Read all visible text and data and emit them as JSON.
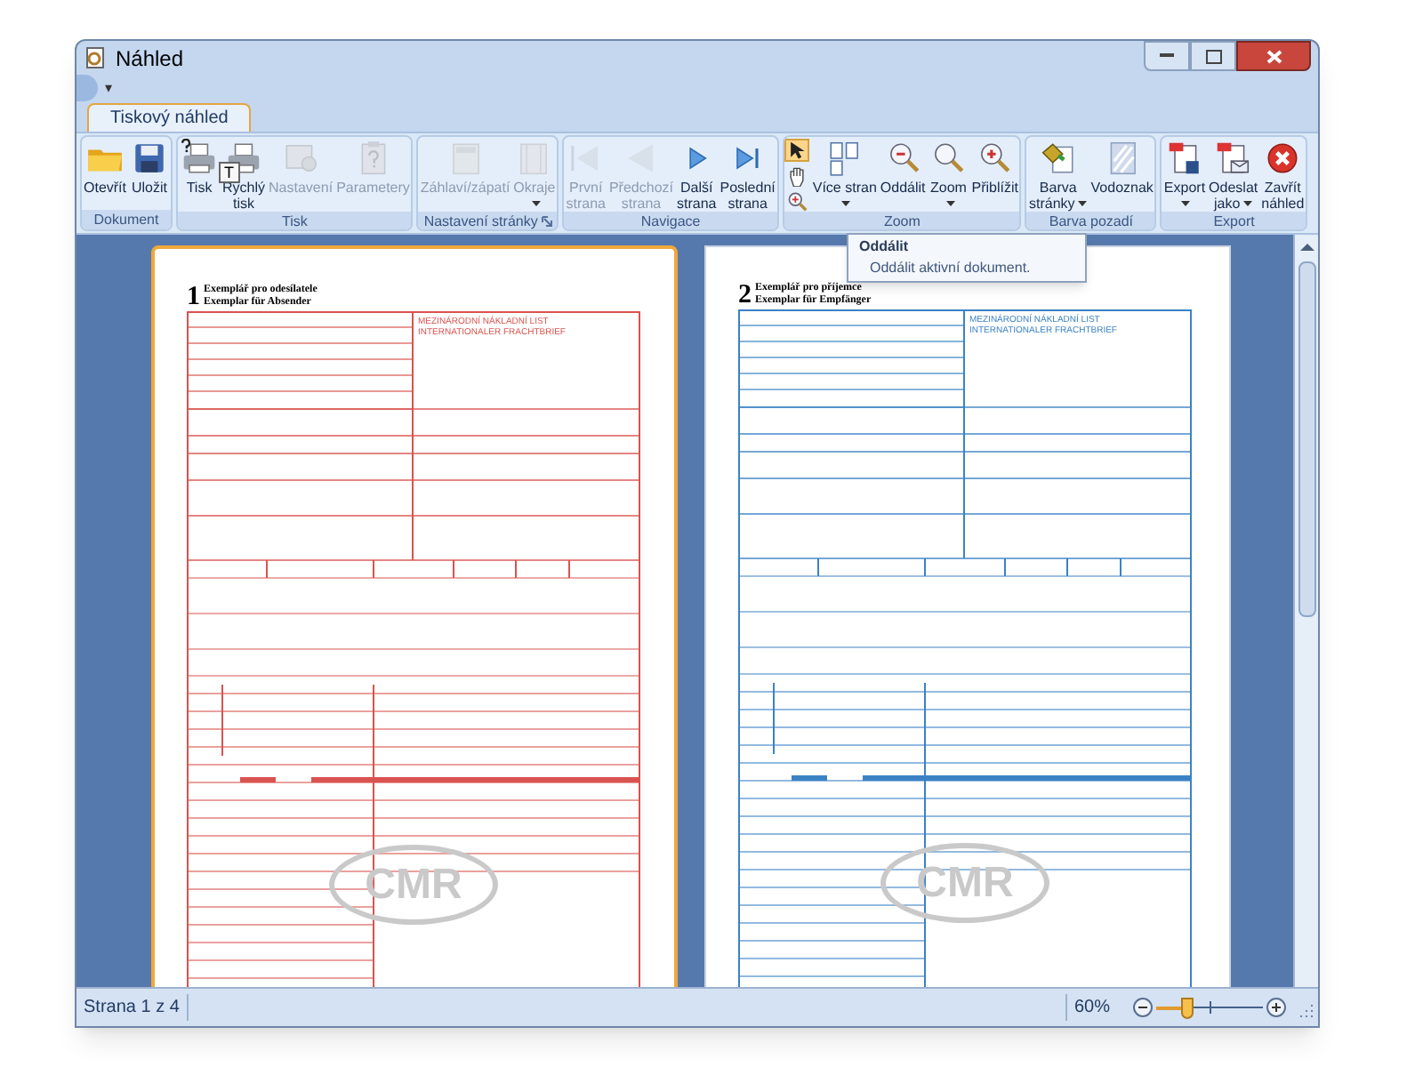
{
  "window": {
    "title": "Náhled"
  },
  "quick_access": {
    "menu_glyph": "▾"
  },
  "tabs": [
    {
      "label": "Tiskový náhled",
      "selected": true
    }
  ],
  "keytip": "T",
  "ribbon_groups": [
    {
      "label": "Dokument",
      "launcher": false,
      "buttons": [
        {
          "kind": "folder",
          "lines": [
            "Otevřít"
          ],
          "disabled": false,
          "dropdown": false
        },
        {
          "kind": "save",
          "lines": [
            "Uložit"
          ],
          "disabled": false,
          "dropdown": false
        }
      ]
    },
    {
      "label": "Tisk",
      "launcher": false,
      "buttons": [
        {
          "kind": "print-dialog",
          "lines": [
            "Tisk"
          ],
          "disabled": false,
          "dropdown": false
        },
        {
          "kind": "print",
          "lines": [
            "Rychlý",
            "tisk"
          ],
          "disabled": false,
          "dropdown": false
        },
        {
          "kind": "settings",
          "lines": [
            "Nastavení"
          ],
          "disabled": true,
          "dropdown": false
        },
        {
          "kind": "parameters",
          "lines": [
            "Parametery"
          ],
          "disabled": true,
          "dropdown": false
        }
      ]
    },
    {
      "label": "Nastavení stránky",
      "launcher": true,
      "buttons": [
        {
          "kind": "header",
          "lines": [
            "Záhlaví/zápatí"
          ],
          "disabled": true,
          "dropdown": false
        },
        {
          "kind": "margins",
          "lines": [
            "Okraje"
          ],
          "disabled": true,
          "dropdown": true
        }
      ]
    },
    {
      "label": "Navigace",
      "launcher": false,
      "buttons": [
        {
          "kind": "first",
          "lines": [
            "První",
            "strana"
          ],
          "disabled": true,
          "dropdown": false
        },
        {
          "kind": "prev",
          "lines": [
            "Předchozí",
            "strana"
          ],
          "disabled": true,
          "dropdown": false
        },
        {
          "kind": "next",
          "lines": [
            "Další",
            "strana"
          ],
          "disabled": false,
          "dropdown": false
        },
        {
          "kind": "last",
          "lines": [
            "Poslední",
            "strana"
          ],
          "disabled": false,
          "dropdown": false
        }
      ]
    },
    {
      "label": "Zoom",
      "launcher": false,
      "tools": [
        {
          "kind": "pointer",
          "selected": true
        },
        {
          "kind": "hand",
          "selected": false
        },
        {
          "kind": "magnifier",
          "selected": false
        }
      ],
      "buttons": [
        {
          "kind": "pages",
          "lines": [
            "Více stran"
          ],
          "disabled": false,
          "dropdown": true
        },
        {
          "kind": "zoom-out",
          "lines": [
            "Oddálit"
          ],
          "disabled": false,
          "dropdown": false
        },
        {
          "kind": "zoom",
          "lines": [
            "Zoom"
          ],
          "disabled": false,
          "dropdown": true
        },
        {
          "kind": "zoom-in",
          "lines": [
            "Přiblížit"
          ],
          "disabled": false,
          "dropdown": false
        }
      ]
    },
    {
      "label": "Barva pozadí",
      "launcher": false,
      "buttons": [
        {
          "kind": "paint",
          "lines": [
            "Barva",
            "stránky"
          ],
          "disabled": false,
          "dropdown": true
        },
        {
          "kind": "watermark",
          "lines": [
            "Vodoznak"
          ],
          "disabled": false,
          "dropdown": false
        }
      ]
    },
    {
      "label": "Export",
      "launcher": false,
      "buttons": [
        {
          "kind": "export",
          "lines": [
            "Export"
          ],
          "disabled": false,
          "dropdown": true
        },
        {
          "kind": "send",
          "lines": [
            "Odeslat",
            "jako"
          ],
          "disabled": false,
          "dropdown": true
        },
        {
          "kind": "close",
          "lines": [
            "Zavřít",
            "náhled"
          ],
          "disabled": false,
          "dropdown": false
        }
      ]
    }
  ],
  "tooltip": {
    "title": "Oddálit",
    "text": "Oddálit aktivní dokument."
  },
  "pages": [
    {
      "number": "1",
      "title": "Exemplář pro odesílatele",
      "subtitle": "Exemplar für Absender",
      "heading": "MEZINÁRODNÍ NÁKLADNÍ LIST",
      "heading2": "INTERNATIONALER FRACHTBRIEF",
      "watermark": "CMR",
      "color": "#d9534f",
      "selected": true
    },
    {
      "number": "2",
      "title": "Exemplář pro příjemce",
      "subtitle": "Exemplar für Empfänger",
      "heading": "MEZINÁRODNÍ NÁKLADNÍ LIST",
      "heading2": "INTERNATIONALER FRACHTBRIEF",
      "watermark": "CMR",
      "color": "#3b82c4",
      "selected": false
    }
  ],
  "status_bar": {
    "page": "Strana 1 z 4",
    "zoom": "60%",
    "level": 0.28
  }
}
